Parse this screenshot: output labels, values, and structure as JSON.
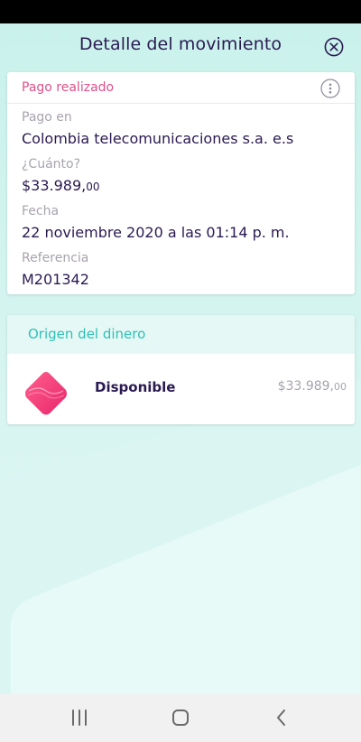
{
  "header": {
    "title": "Detalle del movimiento"
  },
  "movement": {
    "status": "Pago realizado",
    "fields": [
      {
        "label": "Pago en",
        "value": "Colombia telecomunicaciones s.a. e.s"
      },
      {
        "label": "¿Cuánto?",
        "value": "$33.989,",
        "value_cents": "00"
      },
      {
        "label": "Fecha",
        "value": "22 noviembre 2020 a las 01:14 p. m."
      },
      {
        "label": "Referencia",
        "value": "M201342"
      }
    ]
  },
  "origin": {
    "title": "Origen del dinero",
    "name": "Disponible",
    "amount": "$33.989,",
    "amount_cents": "00"
  },
  "icons": {
    "close": "close-circle-icon",
    "more": "more-vertical-icon",
    "pocket": "diamond-pocket-icon",
    "nav_recent": "recent-apps-icon",
    "nav_home": "home-icon",
    "nav_back": "back-icon"
  },
  "colors": {
    "background": "#d2f4ef",
    "primary_text": "#2a1a52",
    "status_pink": "#e0508a",
    "origin_teal": "#2fbfb6",
    "muted_text": "#a8a3ad",
    "icon_gradient_start": "#ff5f8f",
    "icon_gradient_end": "#e8266a"
  }
}
